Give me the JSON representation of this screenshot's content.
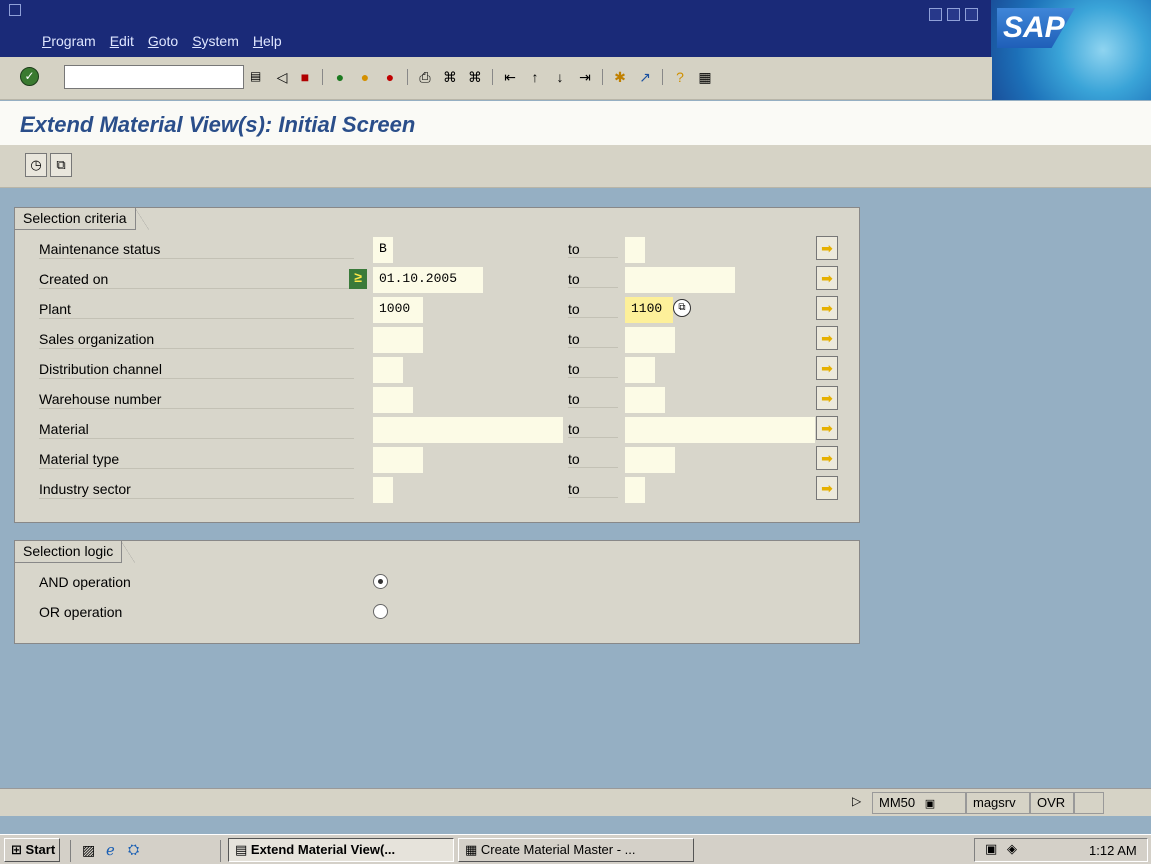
{
  "menu": {
    "items": [
      "Program",
      "Edit",
      "Goto",
      "System",
      "Help"
    ]
  },
  "brand": {
    "logo_text": "SAP"
  },
  "toolbar": {
    "command_value": ""
  },
  "page": {
    "title": "Extend Material View(s): Initial Screen"
  },
  "selection": {
    "group_title": "Selection criteria",
    "to_label": "to",
    "rows": [
      {
        "label": "Maintenance status",
        "low": "B",
        "high": ""
      },
      {
        "label": "Created on",
        "low": "01.10.2005",
        "high": "",
        "option": "≥"
      },
      {
        "label": "Plant",
        "low": "1000",
        "high": "1100"
      },
      {
        "label": "Sales organization",
        "low": "",
        "high": ""
      },
      {
        "label": "Distribution channel",
        "low": "",
        "high": ""
      },
      {
        "label": "Warehouse number",
        "low": "",
        "high": ""
      },
      {
        "label": "Material",
        "low": "",
        "high": ""
      },
      {
        "label": "Material type",
        "low": "",
        "high": ""
      },
      {
        "label": "Industry sector",
        "low": "",
        "high": ""
      }
    ]
  },
  "logic": {
    "group_title": "Selection logic",
    "options": [
      {
        "label": "AND operation",
        "selected": true
      },
      {
        "label": "OR operation",
        "selected": false
      }
    ]
  },
  "status": {
    "transaction": "MM50",
    "server": "magsrv",
    "mode": "OVR"
  },
  "taskbar": {
    "start": "Start",
    "tasks": [
      "Extend Material View(...",
      "Create Material Master - ..."
    ],
    "clock": "1:12 AM"
  }
}
